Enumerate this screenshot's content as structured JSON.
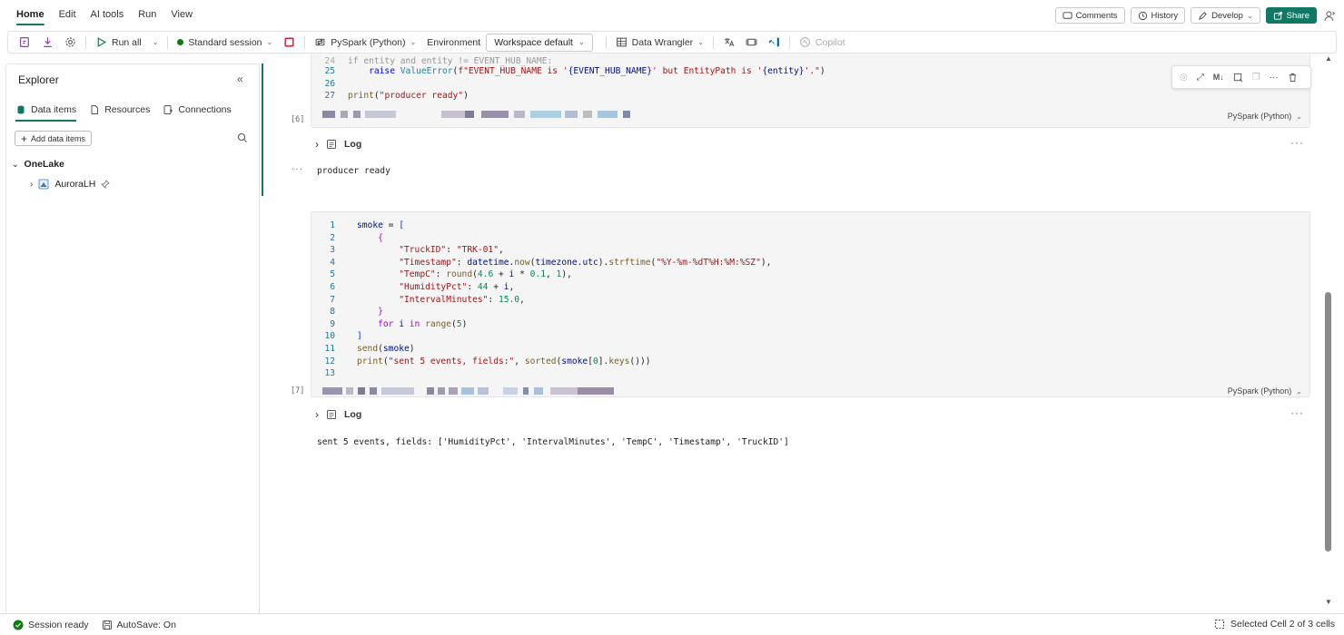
{
  "menu": {
    "tabs": [
      "Home",
      "Edit",
      "AI tools",
      "Run",
      "View"
    ],
    "active": "Home"
  },
  "header_actions": {
    "comments": "Comments",
    "history": "History",
    "develop": "Develop",
    "share": "Share"
  },
  "toolbar": {
    "run_all": "Run all",
    "session": "Standard session",
    "language": "PySpark (Python)",
    "environment_label": "Environment",
    "environment_value": "Workspace default",
    "data_wrangler": "Data Wrangler",
    "copilot": "Copilot"
  },
  "explorer": {
    "title": "Explorer",
    "tabs": [
      "Data items",
      "Resources",
      "Connections"
    ],
    "add_button": "Add data items",
    "root": "OneLake",
    "lakehouse": "AuroraLH"
  },
  "cell1": {
    "exec_count": "[6]",
    "language": "PySpark (Python)",
    "line_numbers": [
      "25",
      "26",
      "27"
    ],
    "code": {
      "l25_a": "raise",
      "l25_b": "ValueError",
      "l25_c": "f\"EVENT_HUB_NAME is '",
      "l25_d": "{EVENT_HUB_NAME}",
      "l25_e": "' but EntityPath is '",
      "l25_f": "{entity}",
      "l25_g": "'.\"",
      "l27_a": "print",
      "l27_b": "\"producer ready\""
    },
    "log_label": "Log",
    "output": "producer ready"
  },
  "cell2": {
    "exec_count": "[7]",
    "language": "PySpark (Python)",
    "line_numbers": [
      "1",
      "2",
      "3",
      "4",
      "5",
      "6",
      "7",
      "8",
      "9",
      "10",
      "11",
      "12",
      "13"
    ],
    "code": {
      "l1_var": "smoke",
      "l3_key": "\"TruckID\"",
      "l3_val": "\"TRK-01\"",
      "l4_key": "\"Timestamp\"",
      "l4_obj": "datetime",
      "l4_fn": "now",
      "l4_tz": "timezone",
      "l4_utc": "utc",
      "l4_fn2": "strftime",
      "l4_fmt": "\"%Y-%m-%dT%H:%M:%SZ\"",
      "l5_key": "\"TempC\"",
      "l5_fn": "round",
      "l5_n1": "4.6",
      "l5_i": "i",
      "l5_n2": "0.1",
      "l5_n3": "1",
      "l6_key": "\"HumidityPct\"",
      "l6_n": "44",
      "l6_i": "i",
      "l7_key": "\"IntervalMinutes\"",
      "l7_n": "15.0",
      "l9_for": "for",
      "l9_i": "i",
      "l9_in": "in",
      "l9_fn": "range",
      "l9_n": "5",
      "l11_fn": "send",
      "l11_var": "smoke",
      "l12_fn": "print",
      "l12_str": "\"sent 5 events, fields:\"",
      "l12_fn2": "sorted",
      "l12_var": "smoke",
      "l12_n": "0",
      "l12_fn3": "keys"
    },
    "log_label": "Log",
    "output": "sent 5 events, fields: ['HumidityPct', 'IntervalMinutes', 'TempC', 'Timestamp', 'TruckID']"
  },
  "status": {
    "session": "Session ready",
    "autosave": "AutoSave: On",
    "selection": "Selected Cell 2 of 3 cells"
  },
  "colors": {
    "accent": "#117865",
    "keyword": "#0000ff",
    "string": "#a31515",
    "function": "#795e26",
    "variable": "#001080",
    "number": "#098658"
  }
}
